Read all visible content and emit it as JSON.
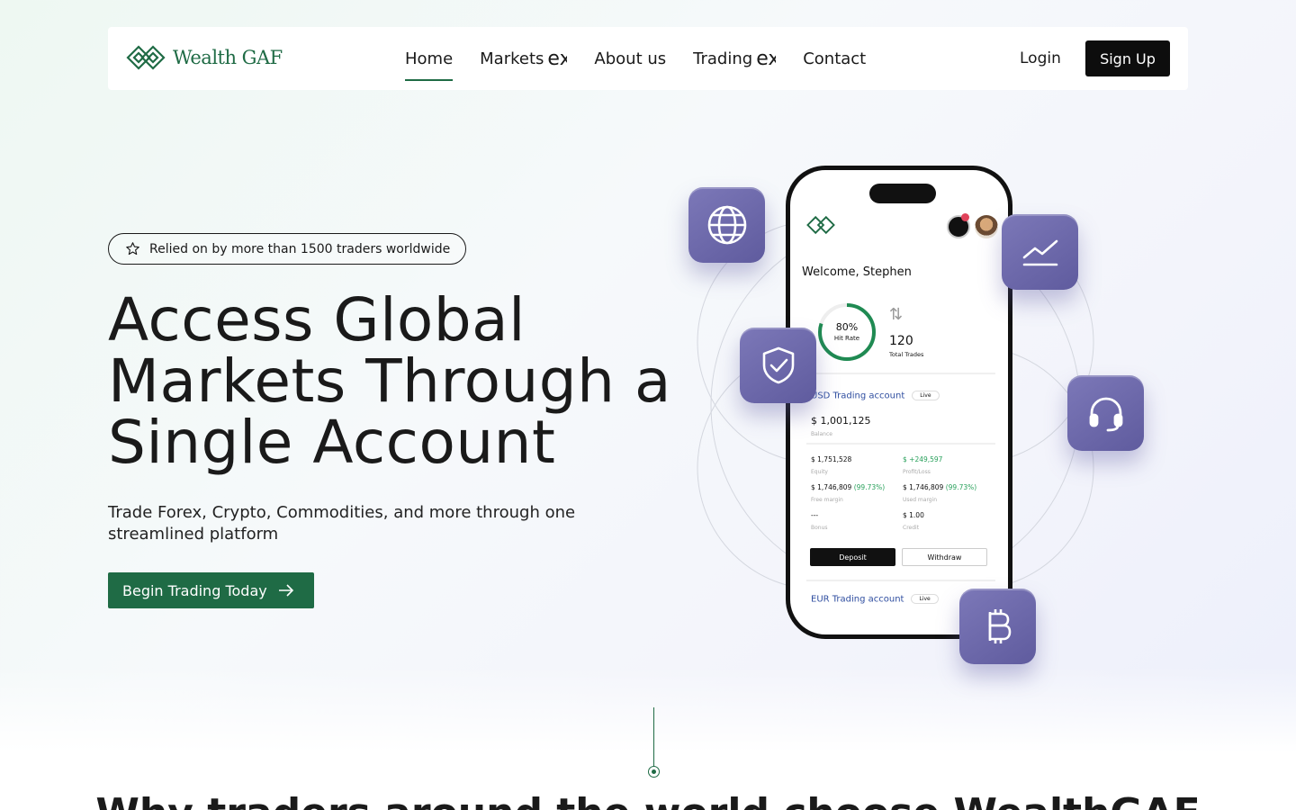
{
  "brand": {
    "name": "Wealth GAF",
    "accent": "#1f6b45",
    "tile_color": "#6e6aad"
  },
  "nav": {
    "links": [
      {
        "label": "Home",
        "active": true
      },
      {
        "label": "Markets",
        "suffix": "ex",
        "active": false
      },
      {
        "label": "About us",
        "active": false
      },
      {
        "label": "Trading",
        "suffix": "ex",
        "active": false
      },
      {
        "label": "Contact",
        "active": false
      }
    ],
    "login_label": "Login",
    "signup_label": "Sign Up"
  },
  "hero": {
    "badge_text": "Relied on by more than 1500 traders worldwide",
    "badge_icon": "star-icon",
    "title": "Access Global Markets Through a Single Account",
    "subtitle": "Trade Forex, Crypto, Commodities, and more through one streamlined platform",
    "cta_label": "Begin Trading Today",
    "cta_icon": "arrow-right-icon"
  },
  "phone": {
    "welcome": "Welcome, Stephen",
    "hit_rate_value": "80%",
    "hit_rate_label": "Hit Rate",
    "hit_rate_fraction": 0.8,
    "total_trades_value": "120",
    "total_trades_label": "Total Trades",
    "usd_account": {
      "name": "USD Trading account",
      "status": "Live",
      "balance": "$ 1,001,125",
      "balance_label": "Balance",
      "equity": "$ 1,751,528",
      "equity_label": "Equity",
      "profit_loss": "$ +249,597",
      "profit_loss_label": "Profit/Loss",
      "free_margin": "$ 1,746,809",
      "free_margin_pct": "(99.73%)",
      "free_margin_label": "Free margin",
      "used_margin": "$ 1,746,809",
      "used_margin_pct": "(99.73%)",
      "used_margin_label": "Used margin",
      "bonus": "---",
      "bonus_label": "Bonus",
      "credit": "$ 1.00",
      "credit_label": "Credit",
      "deposit_label": "Deposit",
      "withdraw_label": "Withdraw"
    },
    "eur_account": {
      "name": "EUR Trading account",
      "status": "Live"
    }
  },
  "tiles": [
    "globe-icon",
    "chart-line-icon",
    "shield-check-icon",
    "headset-icon",
    "bitcoin-icon"
  ],
  "section": {
    "title": "Why traders around the world choose WealthGAF"
  }
}
